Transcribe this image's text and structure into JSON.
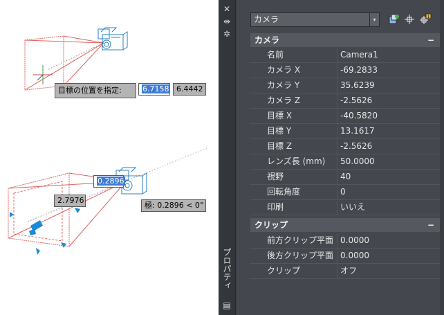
{
  "viewport": {
    "tooltips": {
      "target_prompt_label": "目標の位置を指定:",
      "target_x_input": "6.7158",
      "target_y_input": "6.4442",
      "length_input": "0.2896",
      "distance_readout": "2.7976",
      "polar_readout": "極: 0.2896 < 0°"
    }
  },
  "palette": {
    "side_strip": {
      "close_glyph": "✕",
      "autohide_glyph": "⇹",
      "settings_glyph": "✲",
      "title": "プロパティ",
      "bottom_glyph": "▤"
    },
    "selector": {
      "value": "カメラ",
      "arrow": "▾"
    },
    "icons": [
      "quick-select-icon",
      "select-objects-icon",
      "pickadd-toggle-icon"
    ],
    "sections": [
      {
        "title": "カメラ",
        "toggle": "−",
        "rows": [
          {
            "label": "名前",
            "value": "Camera1"
          },
          {
            "label": "カメラ X",
            "value": "-69.2833"
          },
          {
            "label": "カメラ Y",
            "value": "35.6239"
          },
          {
            "label": "カメラ Z",
            "value": "-2.5626"
          },
          {
            "label": "目標 X",
            "value": "-40.5820"
          },
          {
            "label": "目標 Y",
            "value": "13.1617"
          },
          {
            "label": "目標 Z",
            "value": "-2.5626"
          },
          {
            "label": "レンズ長 (mm)",
            "value": "50.0000"
          },
          {
            "label": "視野",
            "value": "40"
          },
          {
            "label": "回転角度",
            "value": "0"
          },
          {
            "label": "印刷",
            "value": "いいえ"
          }
        ]
      },
      {
        "title": "クリップ",
        "toggle": "−",
        "rows": [
          {
            "label": "前方クリップ平面",
            "value": "0.0000"
          },
          {
            "label": "後方クリップ平面",
            "value": "0.0000"
          },
          {
            "label": "クリップ",
            "value": "オフ"
          }
        ]
      }
    ]
  },
  "colors": {
    "palette_bg": "#44474d",
    "category_bg": "#55595f",
    "frustum": "#e06060",
    "camera_glyph": "#2a7fc0",
    "grip": "#1a8ad6",
    "highlight": "#3d7bd6"
  }
}
